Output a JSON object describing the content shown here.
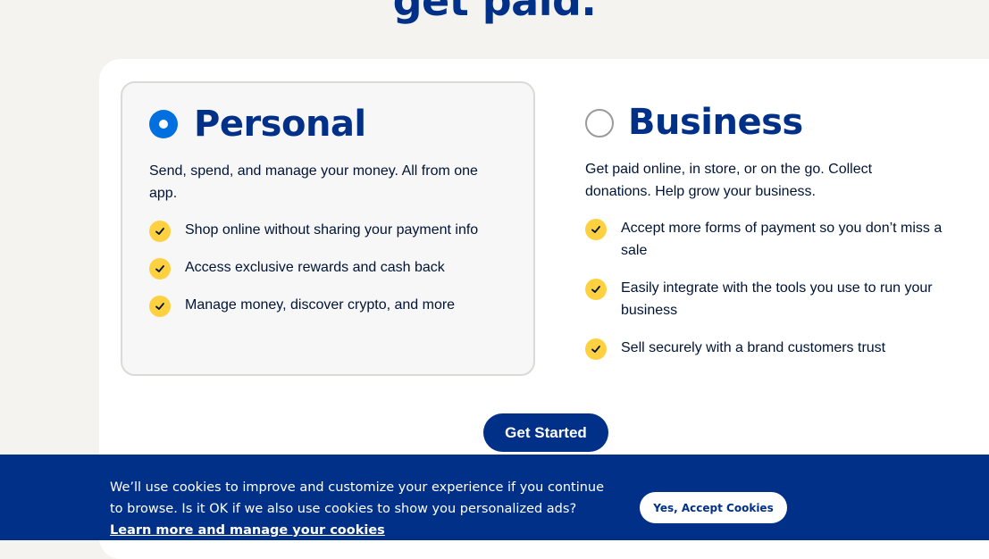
{
  "headline": "get paid.",
  "personal": {
    "title": "Personal",
    "selected": true,
    "description": "Send, spend, and manage your money. All from one app.",
    "features": [
      "Shop online without sharing your payment info",
      "Access exclusive rewards and cash back",
      "Manage money, discover crypto, and more"
    ]
  },
  "business": {
    "title": "Business",
    "selected": false,
    "description": "Get paid online, in store, or on the go. Collect donations. Help grow your business.",
    "features": [
      "Accept more forms of payment so you don’t miss a sale",
      "Easily integrate with the tools you use to run your business",
      "Sell securely with a brand customers trust"
    ]
  },
  "cta": {
    "get_started": "Get Started"
  },
  "cookie_banner": {
    "text": "We’ll use cookies to improve and customize your experience if you continue to browse. Is it OK if we also use cookies to show you personalized ads?",
    "link": "Learn more and manage your cookies",
    "accept": "Yes, Accept Cookies"
  },
  "colors": {
    "brand_blue": "#003087",
    "radio_blue": "#0070e0",
    "check_yellow": "#ffd140",
    "page_bg": "#f5f3ef"
  },
  "icons": [
    "radio-selected-icon",
    "radio-unselected-icon",
    "check-icon"
  ]
}
